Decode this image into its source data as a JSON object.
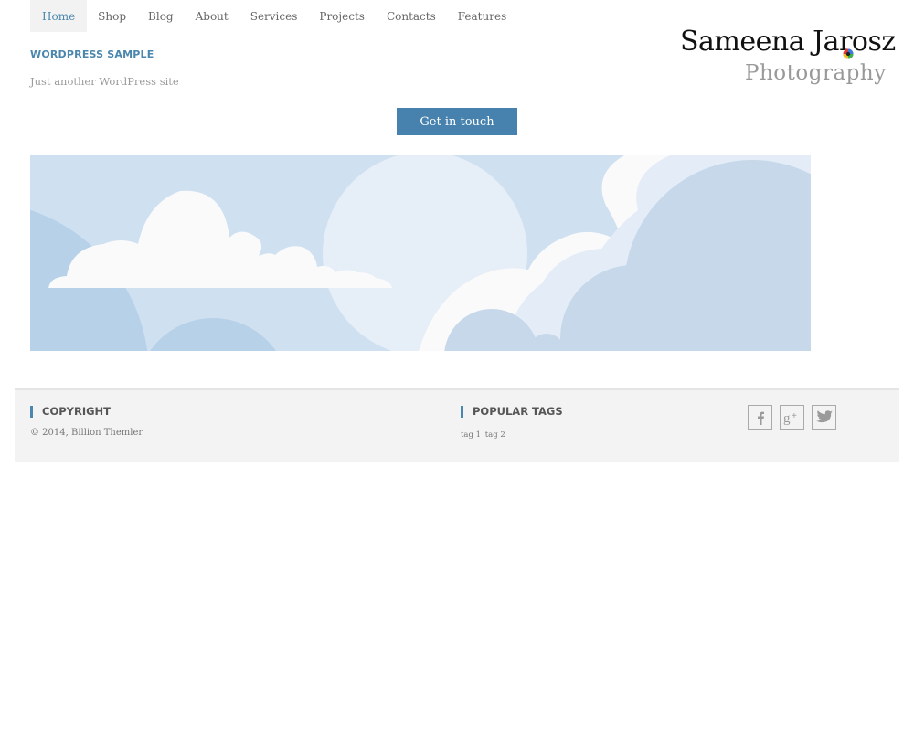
{
  "nav": {
    "items": [
      {
        "label": "Home",
        "active": true
      },
      {
        "label": "Shop"
      },
      {
        "label": "Blog"
      },
      {
        "label": "About"
      },
      {
        "label": "Services"
      },
      {
        "label": "Projects"
      },
      {
        "label": "Contacts"
      },
      {
        "label": "Features"
      }
    ]
  },
  "site": {
    "title": "WORDPRESS SAMPLE",
    "tagline": "Just another WordPress site"
  },
  "logo": {
    "name": "Sameena Jarosz",
    "subtitle": "Photography"
  },
  "cta": {
    "label": "Get in touch"
  },
  "hero": {
    "icon": "clouds-illustration",
    "colors": {
      "sky": "#cfe0f1",
      "cloud_white": "#fafafa",
      "cloud_light": "#e4edf7",
      "cloud_blue": "#c6d8e9",
      "cloud_deep": "#b7d1e9"
    }
  },
  "footer": {
    "copyright_heading": "COPYRIGHT",
    "copyright_text": "© 2014, Billion Themler",
    "tags_heading": "POPULAR TAGS",
    "tags": [
      "tag 1",
      "tag 2"
    ],
    "social": [
      {
        "icon": "facebook-icon",
        "glyph": "f"
      },
      {
        "icon": "google-plus-icon",
        "glyph": "g+"
      },
      {
        "icon": "twitter-icon",
        "glyph": "t"
      }
    ]
  },
  "colors": {
    "accent": "#4682ad",
    "footer_bg": "#f3f3f3"
  }
}
